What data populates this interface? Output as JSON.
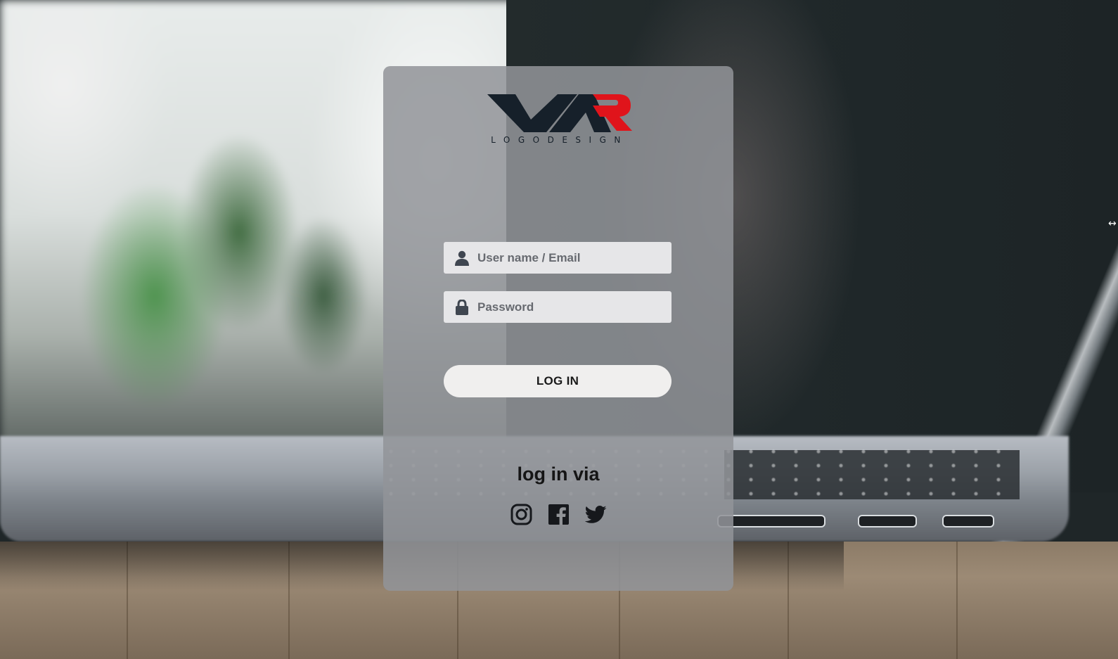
{
  "brand": {
    "logo_letters": "VAR",
    "logo_subtitle": "LOGODESIGN",
    "colors": {
      "dark": "#16202a",
      "accent": "#e0141b"
    }
  },
  "form": {
    "username": {
      "placeholder": "User name / Email",
      "icon": "user-icon"
    },
    "password": {
      "placeholder": "Password",
      "icon": "lock-icon"
    },
    "submit_label": "LOG IN"
  },
  "social_login": {
    "label": "log in via",
    "providers": [
      {
        "name": "instagram",
        "icon": "instagram-icon"
      },
      {
        "name": "facebook",
        "icon": "facebook-icon"
      },
      {
        "name": "twitter",
        "icon": "twitter-icon"
      }
    ]
  }
}
